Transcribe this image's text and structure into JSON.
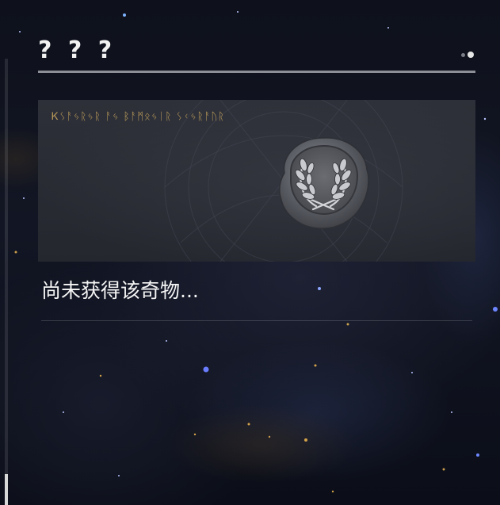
{
  "title": "? ? ?",
  "pagination": {
    "pages": 2,
    "current": 2
  },
  "card": {
    "runes_text": "Ꮶᛊᚨᛃᚱᛃᚱ ᚨᛃ ᛒᚨᛗᛟᛃᛁᚱ ᛊᚲᛃᚱᚨᚢᚱ",
    "image": "laurel-wreath-wax-seal"
  },
  "status_text": "尚未获得该奇物...",
  "scrollbar": {
    "position_fraction": 1.0
  },
  "colors": {
    "accent_gold": "#bf9f5a",
    "text": "#f5f5f5",
    "card_bg": "#2b2d35",
    "underline": "#8d8f96"
  }
}
